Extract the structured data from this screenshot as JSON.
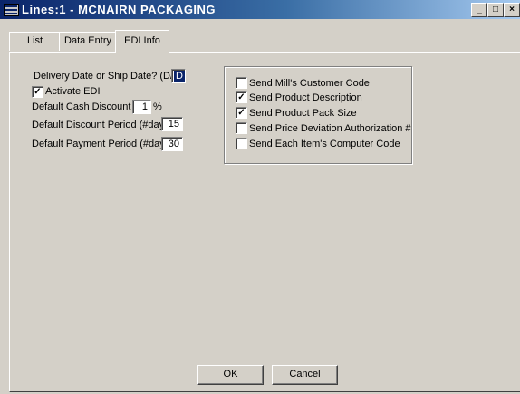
{
  "window": {
    "title": "Lines:1 - MCNAIRN PACKAGING"
  },
  "caption_buttons": {
    "minimize": "_",
    "maximize": "□",
    "close": "×"
  },
  "tabs": [
    {
      "label": "List"
    },
    {
      "label": "Data Entry"
    },
    {
      "label": "EDI Info",
      "active": true
    }
  ],
  "form": {
    "delivery_label": "Delivery Date or Ship Date? (D/S)",
    "delivery_value": "D",
    "activate_edi_label": "Activate EDI",
    "activate_edi_checked": true,
    "cash_discount_label": "Default Cash Discount",
    "cash_discount_value": "1",
    "cash_discount_unit": "%",
    "discount_period_label": "Default Discount Period (#days)",
    "discount_period_value": "15",
    "payment_period_label": "Default Payment Period (#days)",
    "payment_period_value": "30"
  },
  "options": [
    {
      "label": "Send Mill's Customer Code",
      "checked": false
    },
    {
      "label": "Send Product Description",
      "checked": true
    },
    {
      "label": "Send Product Pack Size",
      "checked": true
    },
    {
      "label": "Send Price Deviation Authorization #",
      "checked": false
    },
    {
      "label": "Send Each Item's Computer Code",
      "checked": false
    }
  ],
  "buttons": {
    "ok": "OK",
    "cancel": "Cancel"
  }
}
